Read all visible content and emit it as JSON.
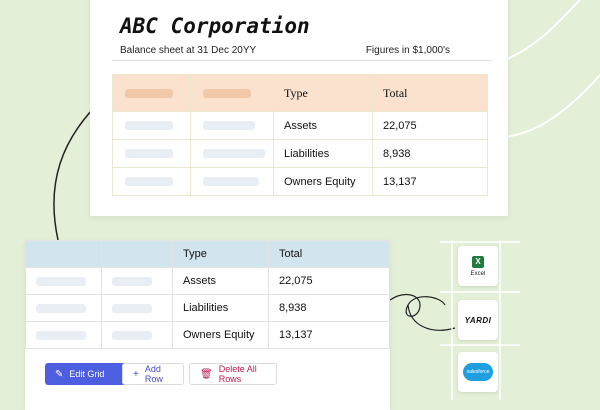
{
  "top_card": {
    "company": "ABC Corporation",
    "subtitle": "Balance sheet at 31 Dec 20YY",
    "figures_note": "Figures in $1,000's",
    "table": {
      "headers": [
        "",
        "",
        "Type",
        "Total"
      ],
      "rows": [
        {
          "type": "Assets",
          "total": "22,075"
        },
        {
          "type": "Liabilities",
          "total": "8,938"
        },
        {
          "type": "Owners Equity",
          "total": "13,137"
        }
      ]
    }
  },
  "bottom_card": {
    "table": {
      "headers": [
        "",
        "",
        "Type",
        "Total"
      ],
      "rows": [
        {
          "type": "Assets",
          "total": "22,075"
        },
        {
          "type": "Liabilities",
          "total": "8,938"
        },
        {
          "type": "Owners Equity",
          "total": "13,137"
        }
      ]
    },
    "buttons": {
      "edit": "Edit Grid",
      "add": "Add Row",
      "delete": "Delete All Rows"
    }
  },
  "integrations": {
    "excel": {
      "mark": "X",
      "label": "Excel"
    },
    "yardi": {
      "label": "YARDI"
    },
    "salesforce": {
      "label": "salesforce"
    }
  },
  "colors": {
    "background": "#e3efd6",
    "header_orange": "#fbe2cf",
    "header_blue": "#d2e5ef",
    "primary_button": "#4d5ee0",
    "delete_text": "#b81e4f"
  },
  "icons": {
    "edit": "pencil-icon",
    "add": "plus-icon",
    "delete": "trash-icon"
  }
}
